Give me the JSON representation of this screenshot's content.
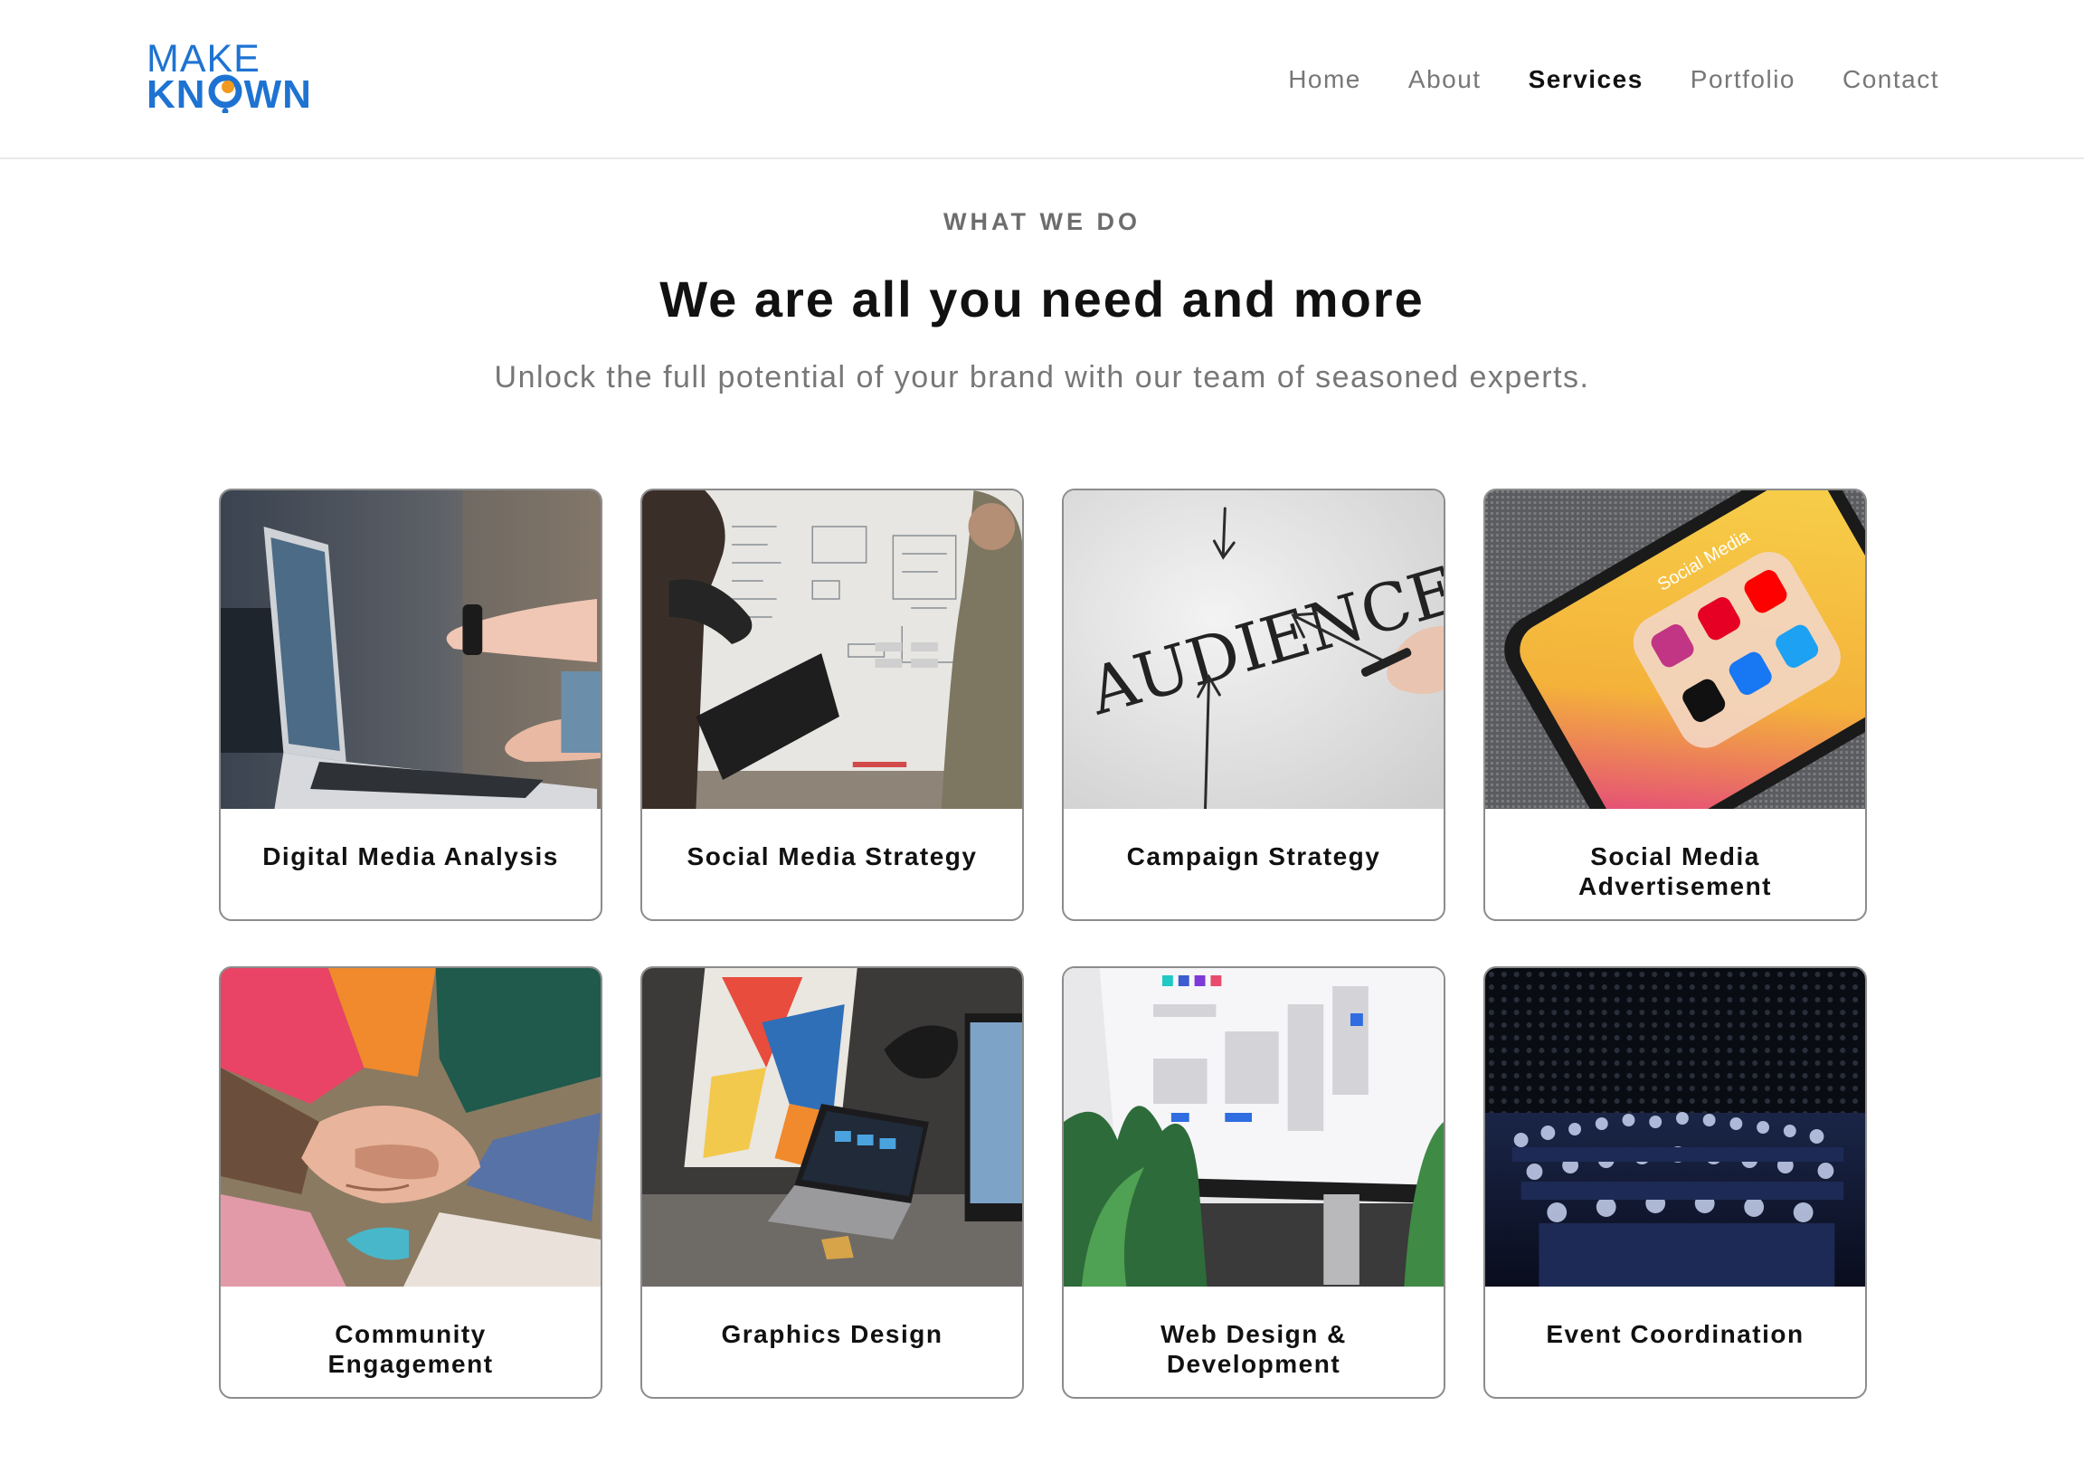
{
  "brand": {
    "line1": "MAKE",
    "line2_left": "KN",
    "line2_right": "WN"
  },
  "nav": {
    "items": [
      {
        "label": "Home"
      },
      {
        "label": "About"
      },
      {
        "label": "Services"
      },
      {
        "label": "Portfolio"
      },
      {
        "label": "Contact"
      }
    ],
    "active": "Services"
  },
  "intro": {
    "eyebrow": "WHAT WE DO",
    "title": "We are all you need and more",
    "subtitle": "Unlock the full potential of your brand with our team of seasoned experts."
  },
  "colors": {
    "brand_blue": "#1e73d2",
    "brand_orange": "#f29a1f"
  },
  "services": [
    {
      "label": "Digital Media Analysis",
      "image": "laptop-pointing-photo"
    },
    {
      "label": "Social Media Strategy",
      "image": "whiteboard-team-photo"
    },
    {
      "label": "Campaign Strategy",
      "image": "audience-whiteboard-photo"
    },
    {
      "label": "Social Media Advertisement",
      "image": "phone-social-apps-photo"
    },
    {
      "label": "Community Engagement",
      "image": "stacked-hands-photo"
    },
    {
      "label": "Graphics Design",
      "image": "designer-desk-photo"
    },
    {
      "label": "Web Design & Development",
      "image": "monitor-ui-kit-photo"
    },
    {
      "label": "Event Coordination",
      "image": "conference-audience-photo"
    }
  ],
  "audience_word": "AUDIENCE",
  "phone_folder_label": "Social Media"
}
